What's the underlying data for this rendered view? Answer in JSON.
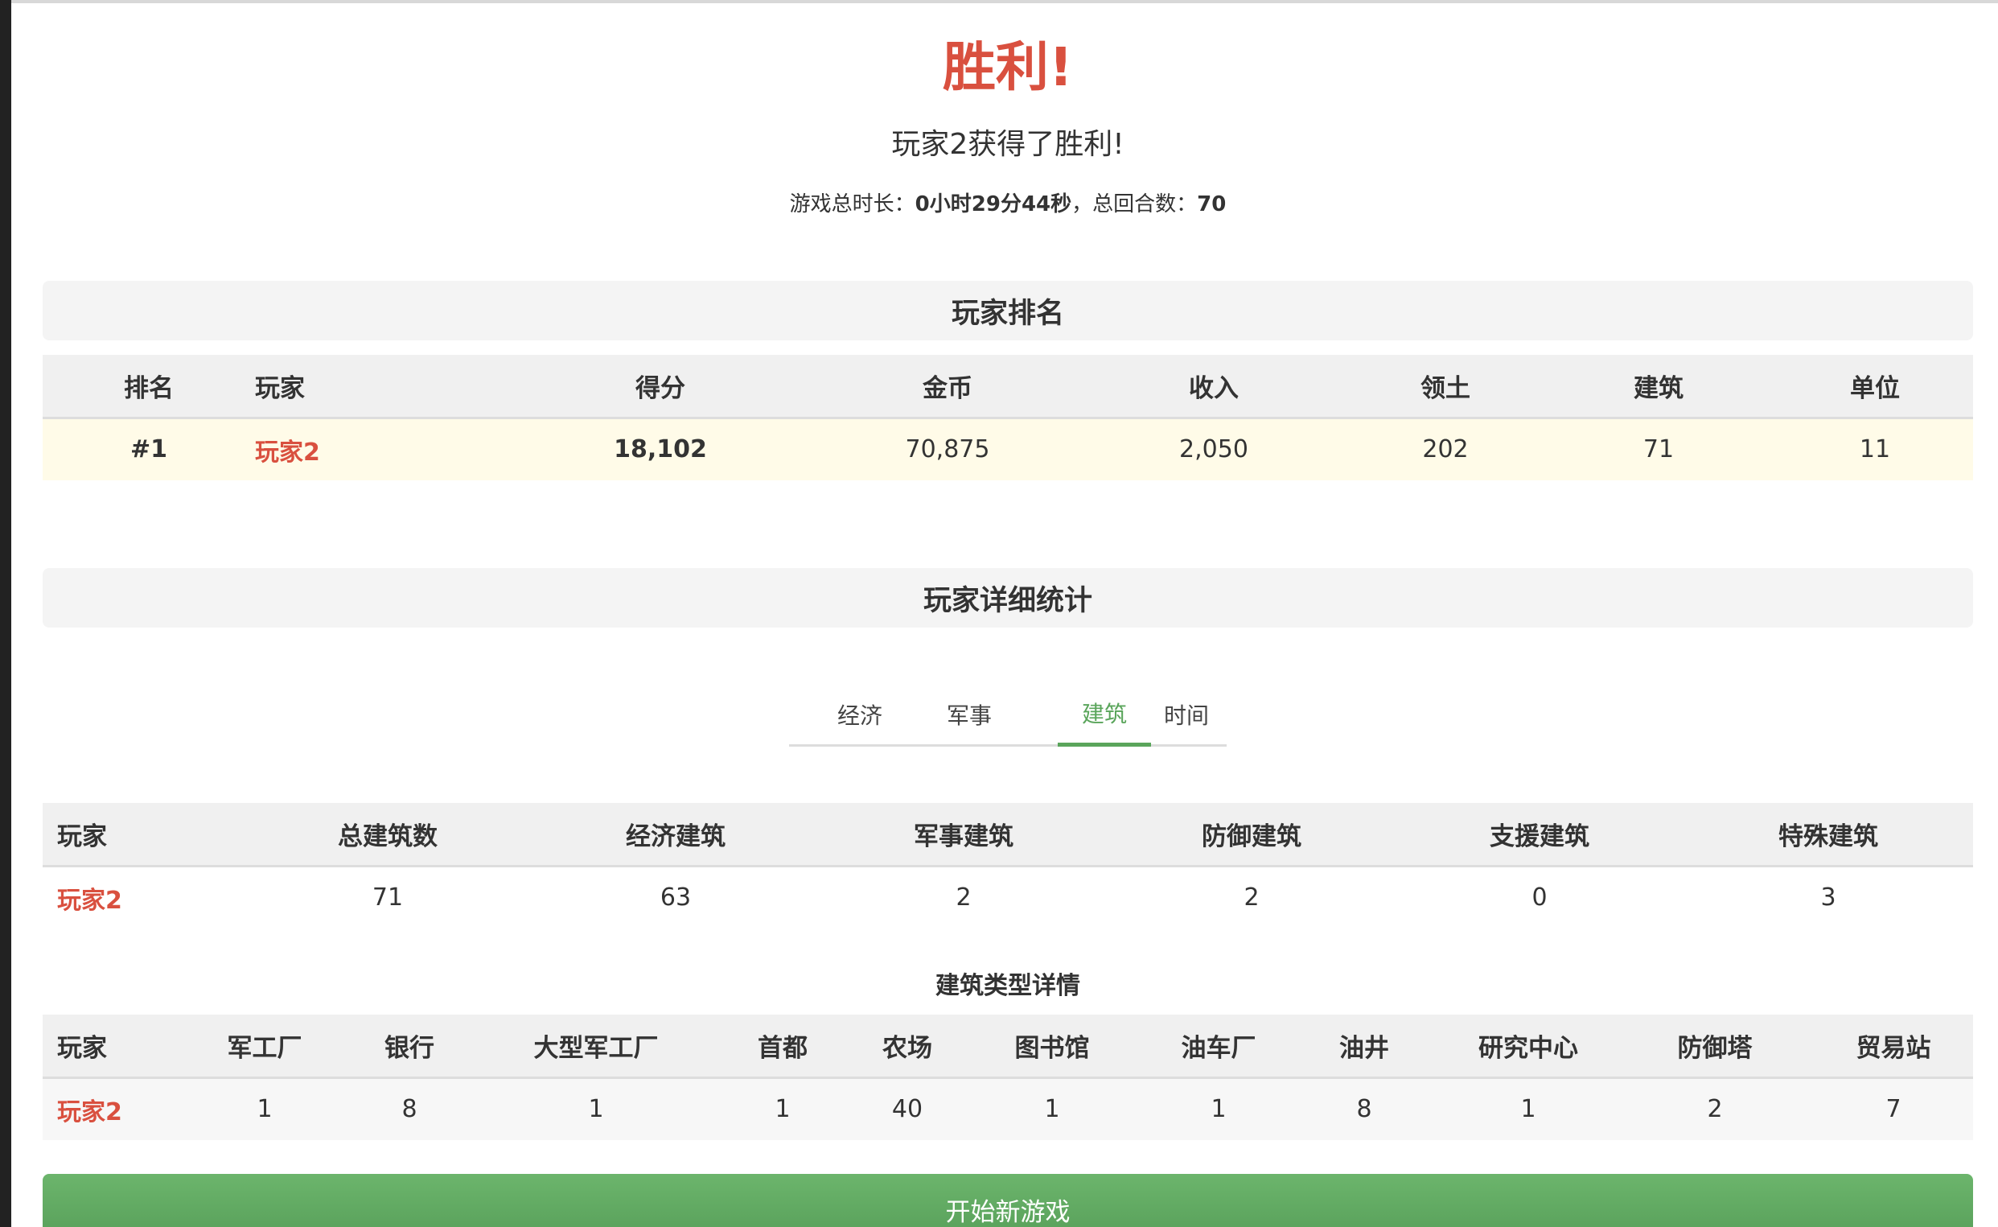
{
  "result": {
    "title": "胜利!",
    "winner_text": "玩家2获得了胜利!",
    "duration_label": "游戏总时长：",
    "duration_value": "0小时29分44秒",
    "rounds_label": "，总回合数：",
    "rounds_value": "70"
  },
  "ranking": {
    "header": "玩家排名",
    "columns": [
      "排名",
      "玩家",
      "得分",
      "金币",
      "收入",
      "领土",
      "建筑",
      "单位"
    ],
    "rows": [
      {
        "rank": "#1",
        "player": "玩家2",
        "score": "18,102",
        "gold": "70,875",
        "income": "2,050",
        "territory": "202",
        "buildings": "71",
        "units": "11"
      }
    ]
  },
  "details": {
    "header": "玩家详细统计",
    "tabs": [
      {
        "label": "经济",
        "active": false
      },
      {
        "label": "军事",
        "active": false
      },
      {
        "label": "建筑",
        "active": true
      },
      {
        "label": "时间",
        "active": false
      }
    ],
    "building_summary": {
      "columns": [
        "玩家",
        "总建筑数",
        "经济建筑",
        "军事建筑",
        "防御建筑",
        "支援建筑",
        "特殊建筑"
      ],
      "rows": [
        {
          "player": "玩家2",
          "values": [
            "71",
            "63",
            "2",
            "2",
            "0",
            "3"
          ]
        }
      ]
    },
    "building_types": {
      "title": "建筑类型详情",
      "columns": [
        "玩家",
        "军工厂",
        "银行",
        "大型军工厂",
        "首都",
        "农场",
        "图书馆",
        "油车厂",
        "油井",
        "研究中心",
        "防御塔",
        "贸易站"
      ],
      "rows": [
        {
          "player": "玩家2",
          "values": [
            "1",
            "8",
            "1",
            "1",
            "40",
            "1",
            "1",
            "8",
            "1",
            "2",
            "7"
          ]
        }
      ]
    }
  },
  "actions": {
    "new_game": "开始新游戏"
  },
  "colors": {
    "accent_red": "#d9503f",
    "accent_green": "#5aa55b",
    "highlight_row": "#fffbe8"
  }
}
